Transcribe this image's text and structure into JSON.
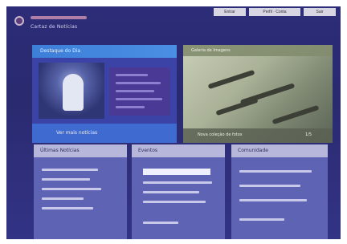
{
  "header": {
    "site_title": "Cartaz de Notícias",
    "buttons": [
      "Entrar",
      "Perfil · Conta",
      "Sair"
    ]
  },
  "hero_left": {
    "title": "Destaque do Dia",
    "caption": "Ver mais notícias"
  },
  "hero_right": {
    "title": "Galeria de Imagens",
    "caption_left": "Nova coleção de fotos",
    "caption_right": "1/5"
  },
  "columns": [
    {
      "title": "Últimas Notícias"
    },
    {
      "title": "Eventos"
    },
    {
      "title": "Comunidade"
    }
  ],
  "colors": {
    "background": "#2c2c78",
    "accent": "#3d7fd8",
    "panel": "#5e63b4"
  }
}
